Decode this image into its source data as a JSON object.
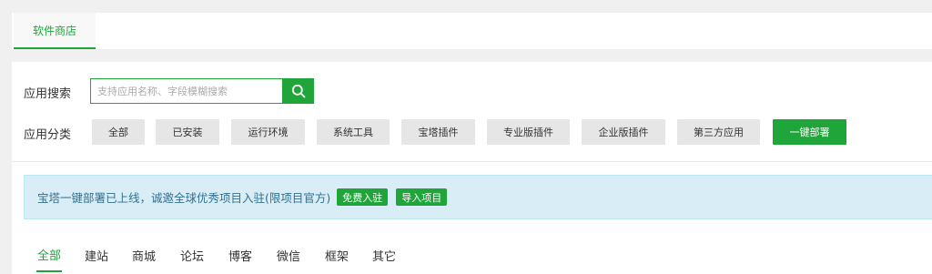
{
  "top_tabs": [
    {
      "label": "软件商店"
    }
  ],
  "search": {
    "label": "应用搜索",
    "placeholder": "支持应用名称、字段模糊搜索",
    "button_icon": "search-icon"
  },
  "categories": {
    "label": "应用分类",
    "items": [
      {
        "label": "全部"
      },
      {
        "label": "已安装"
      },
      {
        "label": "运行环境"
      },
      {
        "label": "系统工具"
      },
      {
        "label": "宝塔插件"
      },
      {
        "label": "专业版插件"
      },
      {
        "label": "企业版插件"
      },
      {
        "label": "第三方应用"
      },
      {
        "label": "一键部署",
        "active": true
      }
    ]
  },
  "notice": {
    "text": "宝塔一键部署已上线，诚邀全球优秀项目入驻(限项目官方)",
    "buttons": [
      {
        "label": "免费入驻"
      },
      {
        "label": "导入项目"
      }
    ]
  },
  "type_tabs": [
    {
      "label": "全部",
      "active": true
    },
    {
      "label": "建站"
    },
    {
      "label": "商城"
    },
    {
      "label": "论坛"
    },
    {
      "label": "博客"
    },
    {
      "label": "微信"
    },
    {
      "label": "框架"
    },
    {
      "label": "其它"
    }
  ],
  "colors": {
    "accent": "#20a53a",
    "notice_bg": "#d9edf7",
    "notice_text": "#31708f"
  }
}
